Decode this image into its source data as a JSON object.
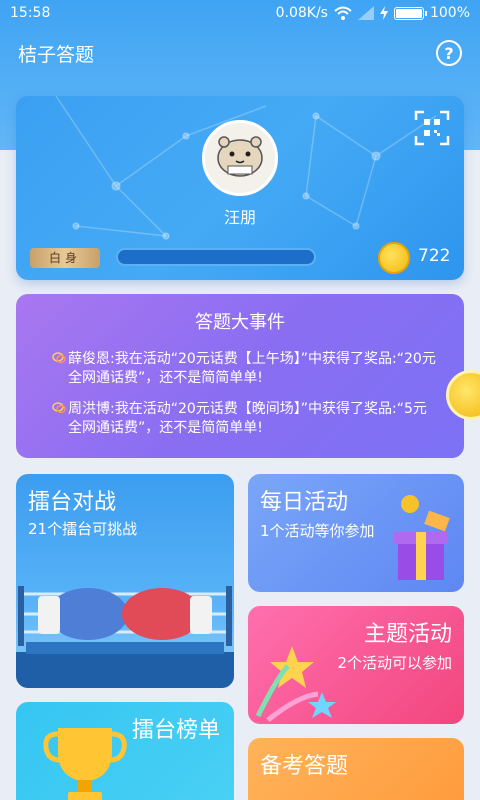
{
  "status_bar": {
    "time": "15:58",
    "network_speed": "0.08K/s",
    "battery": "100%",
    "icons": [
      "wifi-icon",
      "signal-icon",
      "charging-icon",
      "battery-icon"
    ]
  },
  "app_bar": {
    "title": "桔子答题",
    "help_icon": "question-circle-icon"
  },
  "profile": {
    "username": "汪朋",
    "level": "白身",
    "coins": "722",
    "qr_icon": "qr-code-icon",
    "progress": 0
  },
  "events": {
    "title": "答题大事件",
    "items": [
      "薛俊恩:我在活动“20元话费【上午场】”中获得了奖品:“20元全网通话费”，还不是简简单单!",
      "周洪博:我在活动“20元话费【晚间场】”中获得了奖品:“5元全网通话费”，还不是简简单单!"
    ]
  },
  "tiles": {
    "battle": {
      "title": "擂台对战",
      "subtitle": "21个擂台可挑战"
    },
    "daily": {
      "title": "每日活动",
      "subtitle": "1个活动等你参加"
    },
    "topic": {
      "title": "主题活动",
      "subtitle": "2个活动可以参加"
    },
    "rank": {
      "title": "擂台榜单"
    },
    "exam": {
      "title": "备考答题"
    }
  },
  "colors": {
    "header_blue": "#3fa4f4",
    "events_purple": "#8a6ef2",
    "daily_blue": "#5e87f3",
    "topic_pink": "#f2467e",
    "rank_cyan": "#35c6f2",
    "exam_orange": "#ff9a3c",
    "coin_gold": "#f2b90f"
  }
}
